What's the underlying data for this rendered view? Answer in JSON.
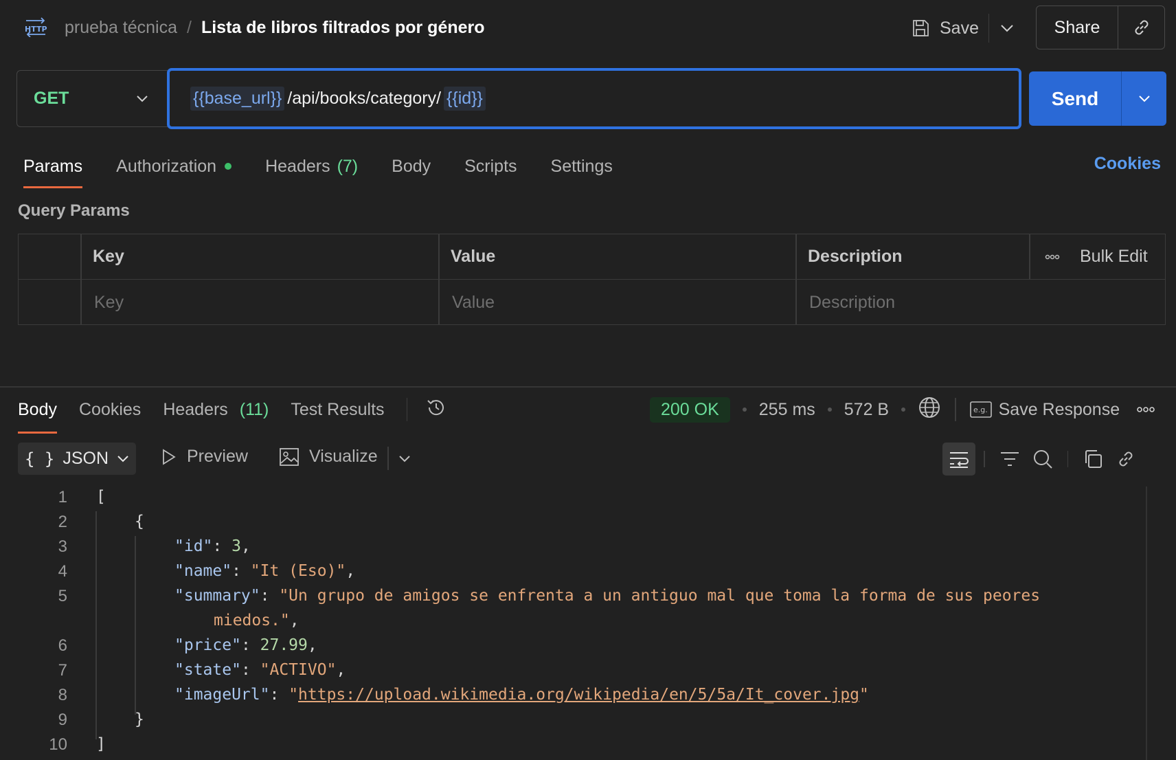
{
  "header": {
    "collection": "prueba técnica",
    "separator": "/",
    "title": "Lista de libros filtrados por género",
    "save_label": "Save",
    "share_label": "Share"
  },
  "request": {
    "method": "GET",
    "url_var1": "{{base_url}}",
    "url_path": "/api/books/category/",
    "url_var2": "{{id}}",
    "send_label": "Send"
  },
  "request_tabs": {
    "params": "Params",
    "authorization": "Authorization",
    "headers": "Headers",
    "headers_count": "(7)",
    "body": "Body",
    "scripts": "Scripts",
    "settings": "Settings",
    "cookies": "Cookies"
  },
  "query_params": {
    "title": "Query Params",
    "columns": [
      "Key",
      "Value",
      "Description"
    ],
    "bulk_edit": "Bulk Edit",
    "placeholders": [
      "Key",
      "Value",
      "Description"
    ]
  },
  "response": {
    "tabs": {
      "body": "Body",
      "cookies": "Cookies",
      "headers": "Headers",
      "headers_count": "(11)",
      "test_results": "Test Results"
    },
    "status": "200 OK",
    "time": "255 ms",
    "size": "572 B",
    "save_response": "Save Response",
    "format": "JSON",
    "preview": "Preview",
    "visualize": "Visualize"
  },
  "code_lines": {
    "l1": "[",
    "l2": "{",
    "l3_key": "\"id\"",
    "l3_val": "3",
    "l4_key": "\"name\"",
    "l4_val": "\"It (Eso)\"",
    "l5_key": "\"summary\"",
    "l5_val": "\"Un grupo de amigos se enfrenta a un antiguo mal que toma la forma de sus peores",
    "l5_wrap": "miedos.\"",
    "l6_key": "\"price\"",
    "l6_val": "27.99",
    "l7_key": "\"state\"",
    "l7_val": "\"ACTIVO\"",
    "l8_key": "\"imageUrl\"",
    "l8_url": "https://upload.wikimedia.org/wikipedia/en/5/5a/It_cover.jpg",
    "l9": "}",
    "l10": "]"
  },
  "line_numbers": [
    "1",
    "2",
    "3",
    "4",
    "5",
    "6",
    "7",
    "8",
    "9",
    "10"
  ],
  "colors": {
    "accent": "#2a69d6",
    "active_tab": "#e8693f",
    "method": "#6bdd9a",
    "status_ok": "#6bdd9a"
  }
}
